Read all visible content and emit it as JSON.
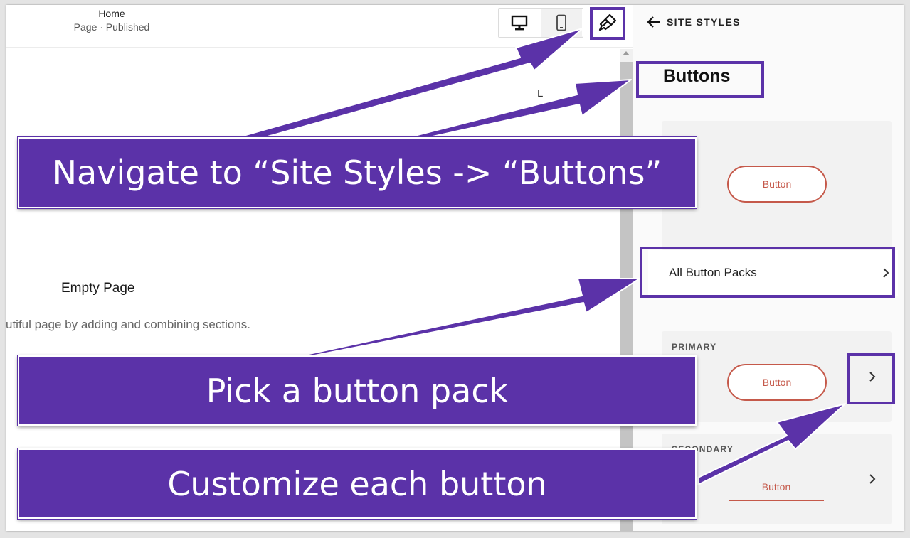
{
  "editor": {
    "page_title": "Home",
    "page_status": "Page · Published",
    "device_toggle": {
      "desktop_icon": "desktop-icon",
      "mobile_icon": "mobile-icon",
      "selected": "desktop"
    },
    "site_styles_icon": "paintbrush-icon",
    "canvas_fragment": "L",
    "empty_title": "Empty Page",
    "empty_description": "utiful page by adding and combining sections."
  },
  "panel": {
    "back_icon": "arrow-left-icon",
    "back_label": "SITE STYLES",
    "heading": "Buttons",
    "preview_button_label": "Button",
    "all_packs_label": "All Button Packs",
    "primary": {
      "label": "PRIMARY",
      "button_label": "Button"
    },
    "secondary": {
      "label": "SECONDARY",
      "button_label": "Button"
    }
  },
  "annotations": {
    "step1": "Navigate to “Site Styles -> “Buttons”",
    "step2": "Pick a button pack",
    "step3": "Customize each button"
  },
  "colors": {
    "annotation_purple": "#5b32a8",
    "button_accent": "#c5594a",
    "panel_background": "#fafafa",
    "card_background": "#f2f2f2"
  }
}
